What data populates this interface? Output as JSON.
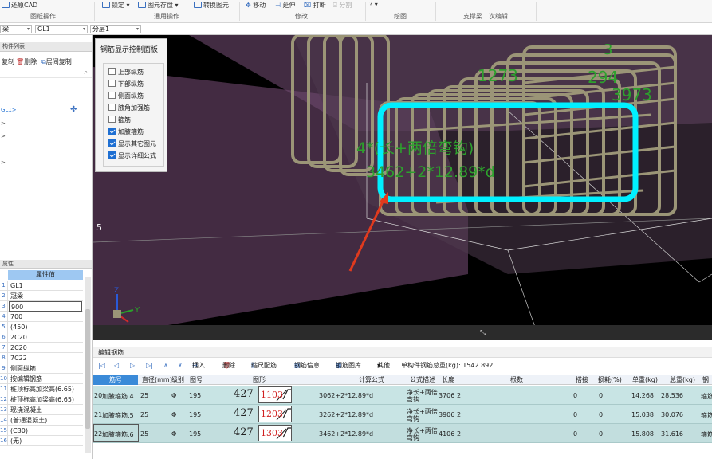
{
  "ribbon": {
    "restore_cad": "还原CAD",
    "lock": "锁定",
    "element_save": "图元存盘",
    "convert_element": "转换图元",
    "move": "移动",
    "extend": "延伸",
    "break": "打断",
    "split": "分割",
    "misc": "?",
    "groups": [
      "图纸操作",
      "通用操作",
      "修改",
      "绘图",
      "支撑梁二次编辑"
    ]
  },
  "filter_bar": {
    "sel_a": "梁",
    "sel_b": "GL1",
    "sel_c": "分层1"
  },
  "left": {
    "top_header": "构件列表",
    "tools": {
      "copy": "复制",
      "delete": "删除",
      "floor_copy": "层间复制"
    },
    "tree_items": [
      "GL1>",
      ">",
      ">",
      ">"
    ],
    "prop_header": "属性",
    "prop_col": "属性值",
    "props": [
      {
        "n": "1",
        "v": "GL1"
      },
      {
        "n": "2",
        "v": "冠梁"
      },
      {
        "n": "3",
        "v": "900"
      },
      {
        "n": "4",
        "v": "700"
      },
      {
        "n": "5",
        "v": "(450)"
      },
      {
        "n": "6",
        "v": "2C20"
      },
      {
        "n": "7",
        "v": "2C20"
      },
      {
        "n": "8",
        "v": "7C22"
      },
      {
        "n": "9",
        "v": "侧面纵筋"
      },
      {
        "n": "10",
        "v": "按编辑钢筋"
      },
      {
        "n": "11",
        "v": "桩顶标高加梁高(6.65)"
      },
      {
        "n": "12",
        "v": "桩顶标高加梁高(6.65)"
      },
      {
        "n": "13",
        "v": "现浇混凝土"
      },
      {
        "n": "14",
        "v": "(普通混凝土)"
      },
      {
        "n": "15",
        "v": "(C30)"
      },
      {
        "n": "16",
        "v": "(无)"
      }
    ]
  },
  "viewport": {
    "panel_title": "钢筋显示控制面板",
    "checks": [
      {
        "label": "上部纵筋",
        "on": false
      },
      {
        "label": "下部纵筋",
        "on": false
      },
      {
        "label": "侧面纵筋",
        "on": false
      },
      {
        "label": "腋角加强筋",
        "on": false
      },
      {
        "label": "箍筋",
        "on": false
      },
      {
        "label": "加腋箍筋",
        "on": true
      },
      {
        "label": "显示其它图元",
        "on": true
      },
      {
        "label": "显示详细公式",
        "on": true
      }
    ],
    "dims": {
      "d1273": "1273",
      "d2944": "294",
      "d3973": "3973",
      "d3": "3",
      "d5": "5"
    },
    "formula_1": "4*(长+两倍弯钩)",
    "formula_2": "3462+2*12.89*d",
    "axis_x": "X",
    "axis_y": "Y",
    "axis_z": "Z"
  },
  "editor": {
    "title": "编辑钢筋",
    "toolbar": {
      "insert": "插入",
      "delete": "删除",
      "scale_bar": "缩尺配筋",
      "rebar_info": "钢筋信息",
      "rebar_lib": "钢筋图库",
      "other": "其他",
      "total": "单构件钢筋总重(kg): 1542.892"
    },
    "headers": [
      "筋号",
      "直径(mm)",
      "级别",
      "图号",
      "图形",
      "计算公式",
      "公式描述",
      "长度",
      "根数",
      "搭接",
      "损耗(%)",
      "单重(kg)",
      "总重(kg)",
      "钢"
    ],
    "rows": [
      {
        "idx": "20",
        "name": "加腋箍筋.4",
        "dia": "25",
        "grade": "Φ",
        "fig": "195",
        "left": "427",
        "shape": "1103",
        "formula": "3062+2*12.89*d",
        "desc1": "净长+两倍",
        "desc2": "弯钩",
        "len": "3706",
        "count": "2",
        "lap": "0",
        "loss": "0",
        "unit": "14.268",
        "total": "28.536",
        "kind": "箍筋"
      },
      {
        "idx": "21",
        "name": "加腋箍筋.5",
        "dia": "25",
        "grade": "Φ",
        "fig": "195",
        "left": "427",
        "shape": "1203",
        "formula": "3262+2*12.89*d",
        "desc1": "净长+两倍",
        "desc2": "弯钩",
        "len": "3906",
        "count": "2",
        "lap": "0",
        "loss": "0",
        "unit": "15.038",
        "total": "30.076",
        "kind": "箍筋"
      },
      {
        "idx": "22",
        "name": "加腋箍筋.6",
        "dia": "25",
        "grade": "Φ",
        "fig": "195",
        "left": "427",
        "shape": "1303",
        "formula": "3462+2*12.89*d",
        "desc1": "净长+两倍",
        "desc2": "弯钩",
        "len": "4106",
        "count": "2",
        "lap": "0",
        "loss": "0",
        "unit": "15.808",
        "total": "31.616",
        "kind": "箍筋"
      }
    ]
  },
  "colors": {
    "accent": "#1e6fd2",
    "highlight": "#00f0ff",
    "dim_text": "#2da02d",
    "arrow": "#e03a1e",
    "row_bg": "#c8e4e4",
    "rebar": "#9b9577"
  }
}
